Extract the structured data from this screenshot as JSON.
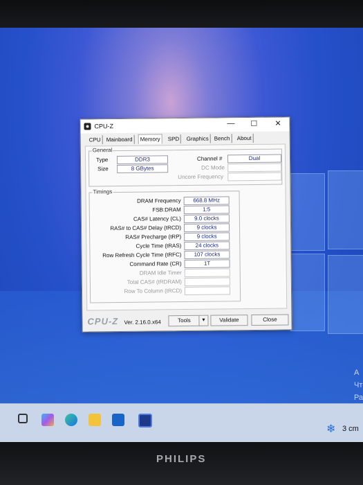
{
  "window": {
    "title": "CPU-Z",
    "controls": {
      "minimize": "—",
      "maximize": "☐",
      "close": "✕"
    }
  },
  "tabs": [
    {
      "label": "CPU",
      "active": false
    },
    {
      "label": "Mainboard",
      "active": false
    },
    {
      "label": "Memory",
      "active": true
    },
    {
      "label": "SPD",
      "active": false
    },
    {
      "label": "Graphics",
      "active": false
    },
    {
      "label": "Bench",
      "active": false
    },
    {
      "label": "About",
      "active": false
    }
  ],
  "general": {
    "legend": "General",
    "type_label": "Type",
    "type_value": "DDR3",
    "size_label": "Size",
    "size_value": "8 GBytes",
    "channel_label": "Channel #",
    "channel_value": "Dual",
    "dc_mode_label": "DC Mode",
    "dc_mode_value": "",
    "uncore_label": "Uncore Frequency",
    "uncore_value": ""
  },
  "timings": {
    "legend": "Timings",
    "rows": [
      {
        "label": "DRAM Frequency",
        "value": "668.8 MHz",
        "dim": false
      },
      {
        "label": "FSB:DRAM",
        "value": "1:5",
        "dim": false
      },
      {
        "label": "CAS# Latency (CL)",
        "value": "9.0 clocks",
        "dim": false
      },
      {
        "label": "RAS# to CAS# Delay (tRCD)",
        "value": "9 clocks",
        "dim": false
      },
      {
        "label": "RAS# Precharge (tRP)",
        "value": "9 clocks",
        "dim": false
      },
      {
        "label": "Cycle Time (tRAS)",
        "value": "24 clocks",
        "dim": false
      },
      {
        "label": "Row Refresh Cycle Time (tRFC)",
        "value": "107 clocks",
        "dim": false
      },
      {
        "label": "Command Rate (CR)",
        "value": "1T",
        "dim": false
      },
      {
        "label": "DRAM Idle Timer",
        "value": "",
        "dim": true
      },
      {
        "label": "Total CAS# (tRDRAM)",
        "value": "",
        "dim": true
      },
      {
        "label": "Row To Column (tRCD)",
        "value": "",
        "dim": true
      }
    ]
  },
  "footer": {
    "logo": "CPU-Z",
    "version": "Ver. 2.16.0.x64",
    "tools_label": "Tools",
    "tools_arrow": "▼",
    "validate_label": "Validate",
    "close_label": "Close"
  },
  "desktop": {
    "right_edge_text": [
      "А",
      "Чт",
      "Ра"
    ]
  },
  "taskbar": {
    "weather_icon": "snowflake-icon",
    "weather_text": "3 cm",
    "weather_glyph": "❄"
  },
  "monitor": {
    "brand": "PHILIPS"
  }
}
